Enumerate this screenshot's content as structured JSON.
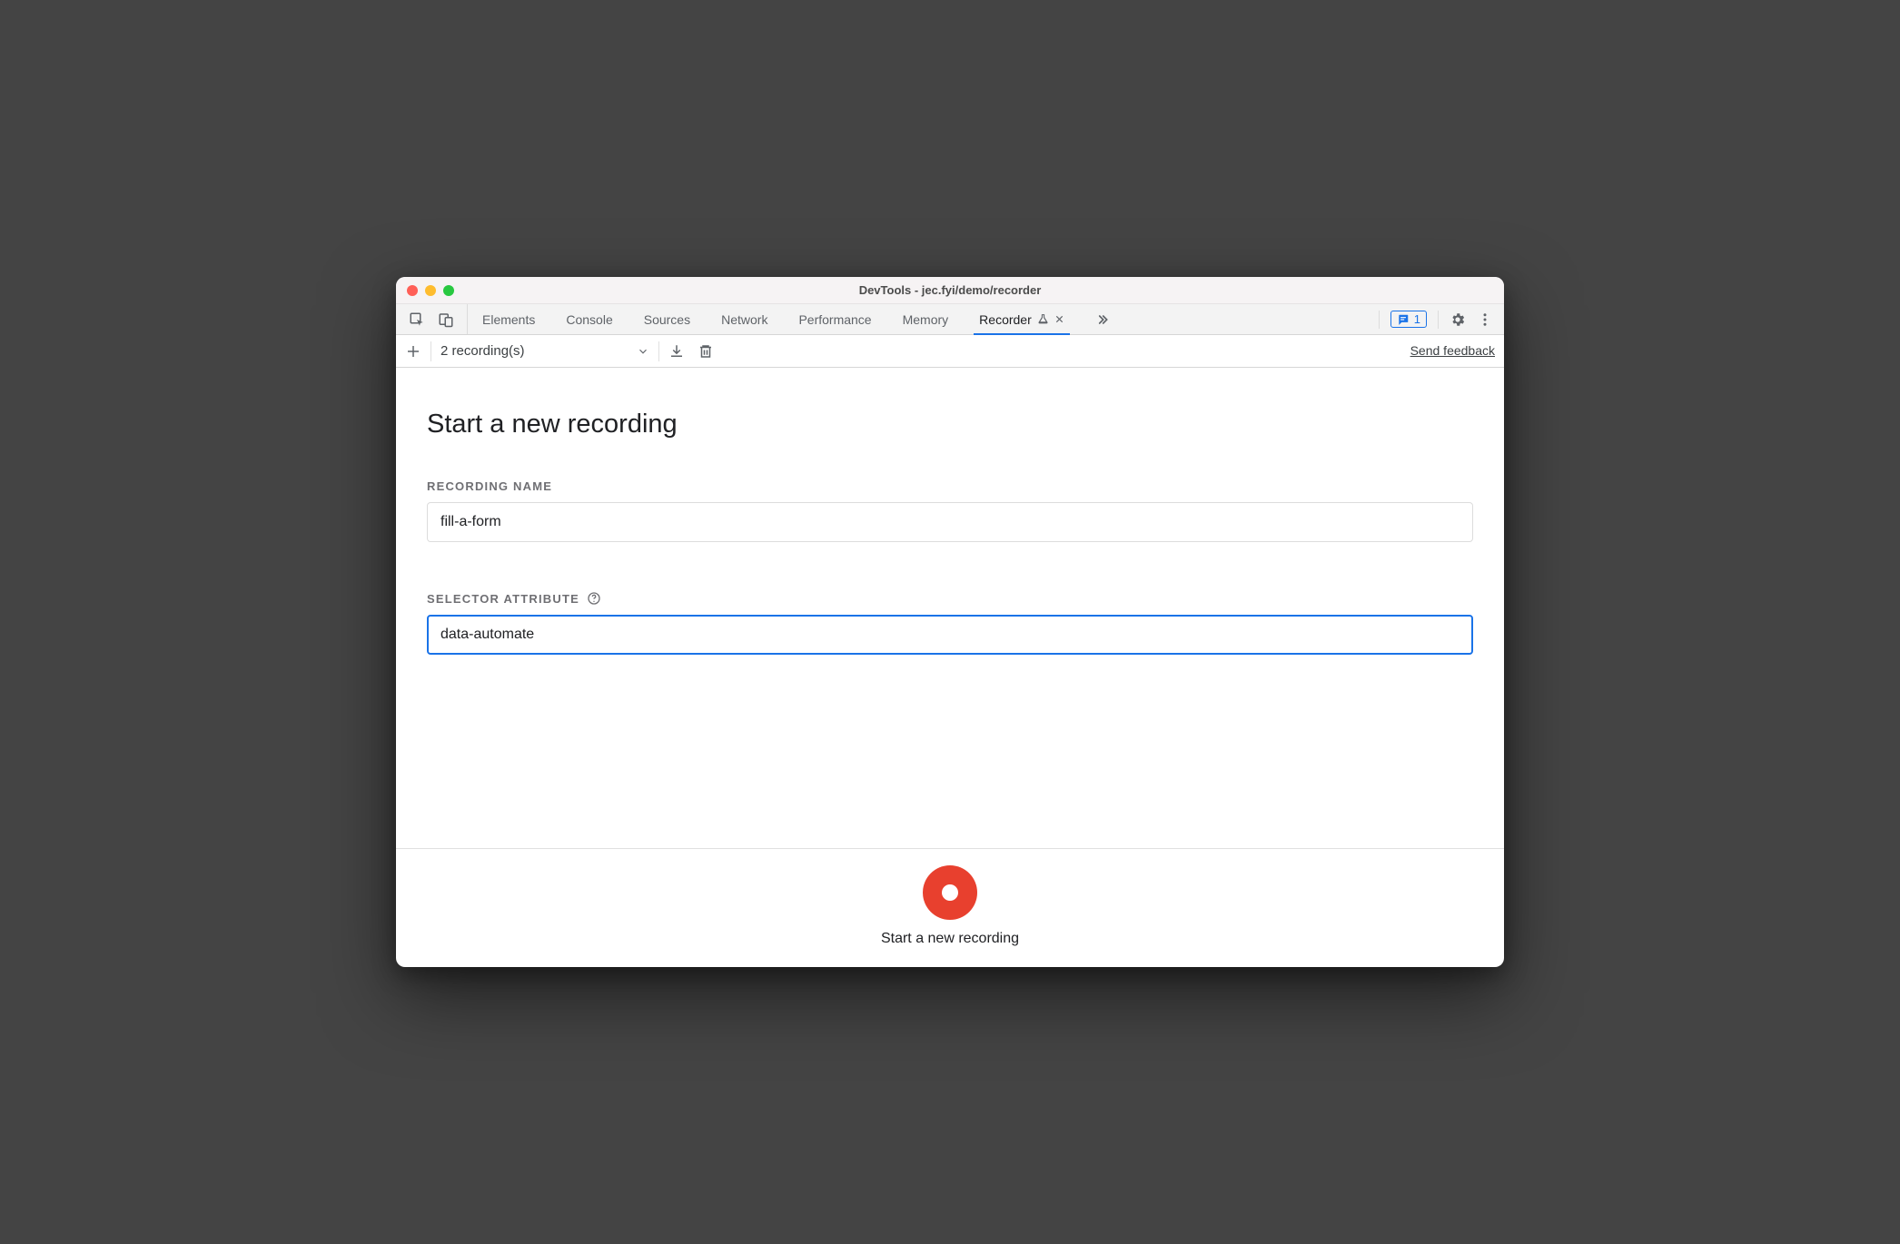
{
  "window": {
    "title": "DevTools - jec.fyi/demo/recorder"
  },
  "tabs": [
    {
      "id": "elements",
      "label": "Elements"
    },
    {
      "id": "console",
      "label": "Console"
    },
    {
      "id": "sources",
      "label": "Sources"
    },
    {
      "id": "network",
      "label": "Network"
    },
    {
      "id": "performance",
      "label": "Performance"
    },
    {
      "id": "memory",
      "label": "Memory"
    },
    {
      "id": "recorder",
      "label": "Recorder",
      "active": true,
      "experimental": true,
      "closable": true
    }
  ],
  "issues": {
    "count": "1"
  },
  "toolbar": {
    "recordings_label": "2 recording(s)",
    "feedback_link": "Send feedback"
  },
  "main": {
    "title": "Start a new recording",
    "recording_name_label": "RECORDING NAME",
    "recording_name_value": "fill-a-form",
    "selector_attribute_label": "SELECTOR ATTRIBUTE",
    "selector_attribute_value": "data-automate"
  },
  "footer": {
    "label": "Start a new recording"
  }
}
